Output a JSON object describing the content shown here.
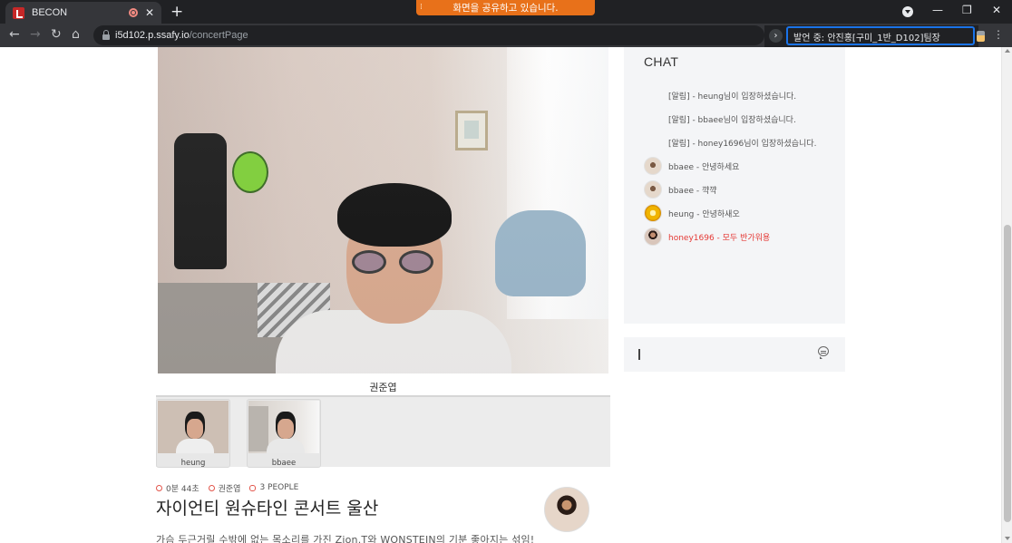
{
  "browser": {
    "tab_title": "BECON",
    "new_tab_symbol": "+",
    "share_banner": "화면을 공유하고 있습니다.",
    "url_host": "i5d102.p.ssafy.io",
    "url_path": "/concertPage",
    "speaker_label": "발언 중: 안진홍[구미_1반_D102]팀장",
    "icons": [
      "back-icon",
      "forward-icon",
      "reload-icon",
      "home-icon",
      "lock-icon",
      "menu-icon"
    ]
  },
  "stage": {
    "main_presenter": "권준엽",
    "participants": [
      {
        "name": "heung"
      },
      {
        "name": "bbaee"
      }
    ]
  },
  "concert": {
    "elapsed": "0분 44초",
    "host": "권준엽",
    "people": "3 PEOPLE",
    "title": "자이언티 원슈타인 콘서트 울산",
    "description": "가슴 두근거릴 수밖에 없는 목소리를 가진 Zion.T와 WONSTEIN의 기분 좋아지는 섞임!"
  },
  "chat": {
    "title": "CHAT",
    "messages": [
      {
        "text": "[알림] - heung님이 입장하셨습니다.",
        "avatar": "none"
      },
      {
        "text": "[알림] - bbaee님이 입장하셨습니다.",
        "avatar": "none"
      },
      {
        "text": "[알림] - honey1696님이 입장하셨습니다.",
        "avatar": "none"
      },
      {
        "text": "bbaee - 안녕하세요",
        "avatar": "bbaee"
      },
      {
        "text": "bbaee - 꺅꺅",
        "avatar": "bbaee"
      },
      {
        "text": "heung - 안녕하새오",
        "avatar": "heung"
      },
      {
        "text": "honey1696 - 모두 반가워용",
        "avatar": "honey",
        "highlight": true
      }
    ],
    "input_value": "",
    "highlight_color": "#e53935"
  }
}
